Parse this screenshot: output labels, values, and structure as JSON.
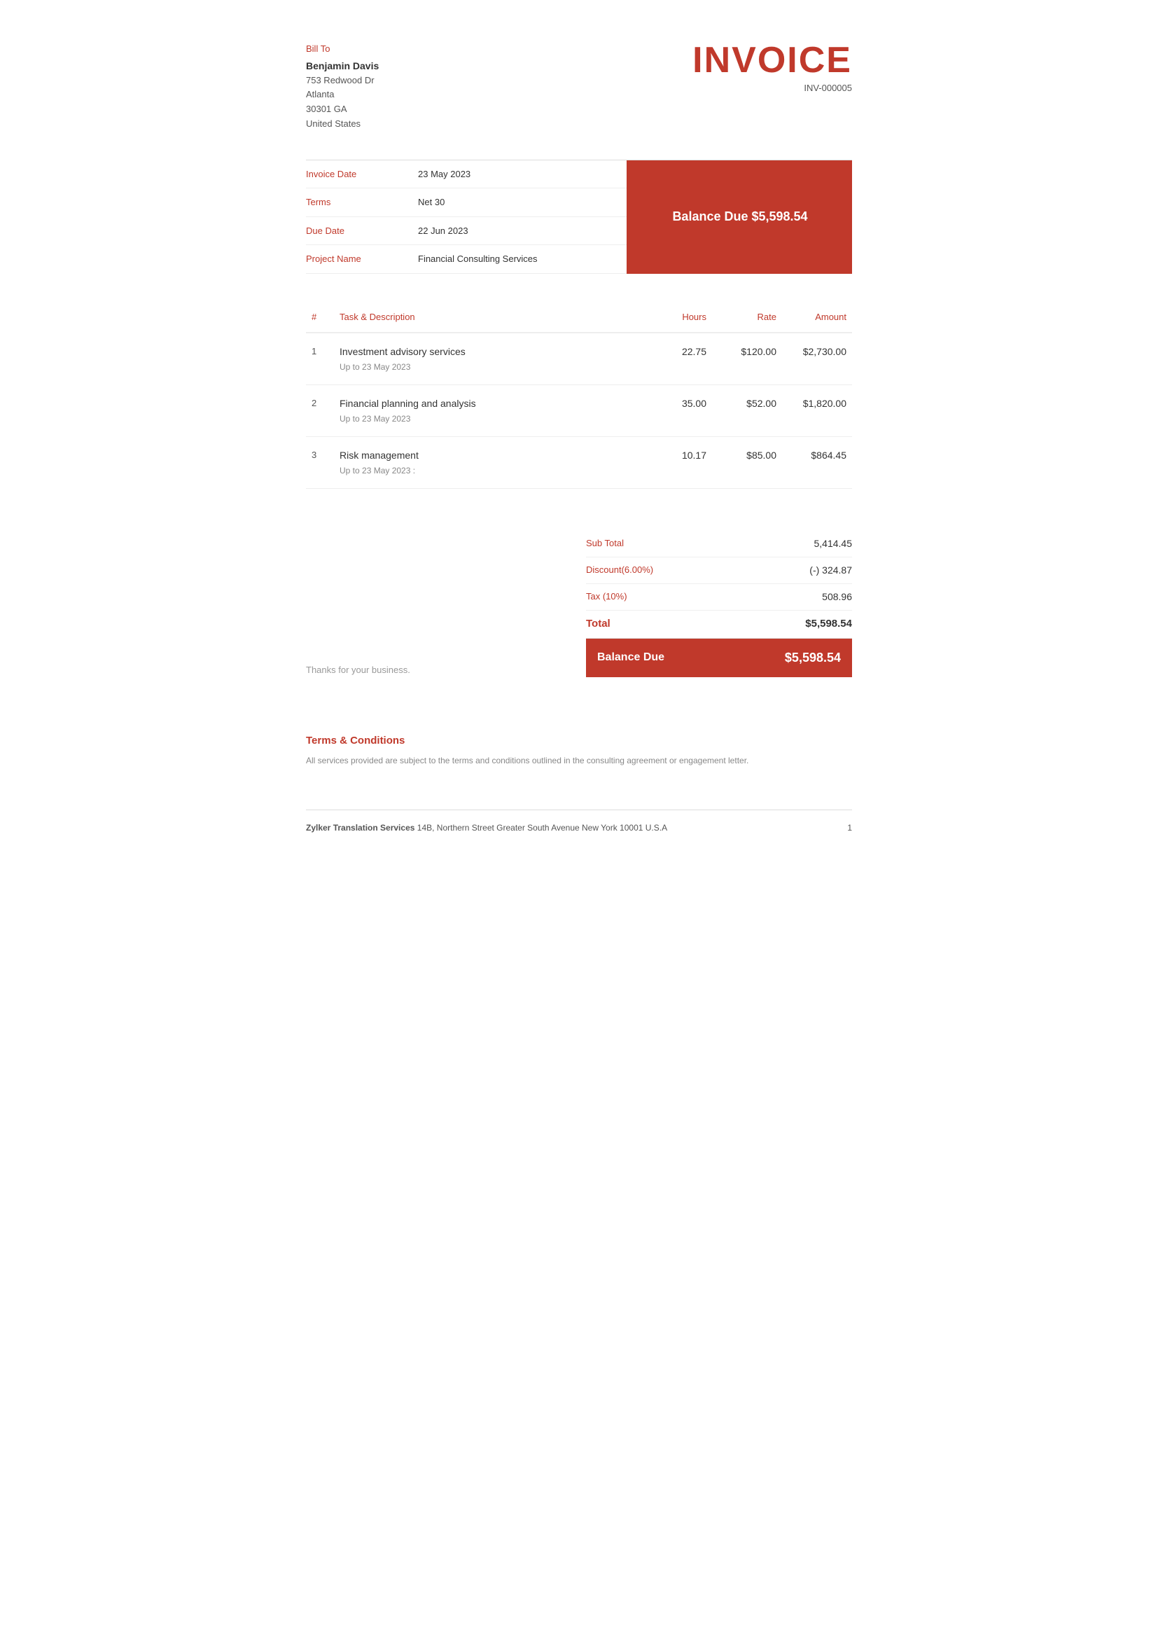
{
  "billTo": {
    "label": "Bill To",
    "name": "Benjamin Davis",
    "address1": "753 Redwood Dr",
    "city": "Atlanta",
    "zipState": "30301 GA",
    "country": "United States"
  },
  "invoice": {
    "title": "INVOICE",
    "number": "INV-000005"
  },
  "balanceDueHeader": "Balance Due $5,598.54",
  "infoRows": [
    {
      "label": "Invoice Date",
      "value": "23 May 2023"
    },
    {
      "label": "Terms",
      "value": "Net 30"
    },
    {
      "label": "Due Date",
      "value": "22 Jun 2023"
    },
    {
      "label": "Project Name",
      "value": "Financial Consulting Services"
    }
  ],
  "table": {
    "headers": {
      "num": "#",
      "taskDescription": "Task & Description",
      "hours": "Hours",
      "rate": "Rate",
      "amount": "Amount"
    },
    "rows": [
      {
        "num": "1",
        "task": "Investment advisory services",
        "description": "Up to 23 May 2023",
        "hours": "22.75",
        "rate": "$120.00",
        "amount": "$2,730.00"
      },
      {
        "num": "2",
        "task": "Financial planning and analysis",
        "description": "Up to 23 May 2023",
        "hours": "35.00",
        "rate": "$52.00",
        "amount": "$1,820.00"
      },
      {
        "num": "3",
        "task": "Risk management",
        "description": "Up to 23 May 2023 :",
        "hours": "10.17",
        "rate": "$85.00",
        "amount": "$864.45"
      }
    ]
  },
  "thanks": "Thanks for your business.",
  "totals": {
    "subTotalLabel": "Sub Total",
    "subTotalValue": "5,414.45",
    "discountLabel": "Discount(6.00%)",
    "discountValue": "(-) 324.87",
    "taxLabel": "Tax (10%)",
    "taxValue": "508.96",
    "totalLabel": "Total",
    "totalValue": "$5,598.54",
    "balanceDueLabel": "Balance Due",
    "balanceDueValue": "$5,598.54"
  },
  "terms": {
    "title": "Terms & Conditions",
    "text": "All services provided are subject to the terms and conditions outlined in the consulting agreement or engagement letter."
  },
  "footer": {
    "companyName": "Zylker Translation Services",
    "address": "14B, Northern Street Greater South Avenue New York 10001 U.S.A",
    "page": "1"
  }
}
